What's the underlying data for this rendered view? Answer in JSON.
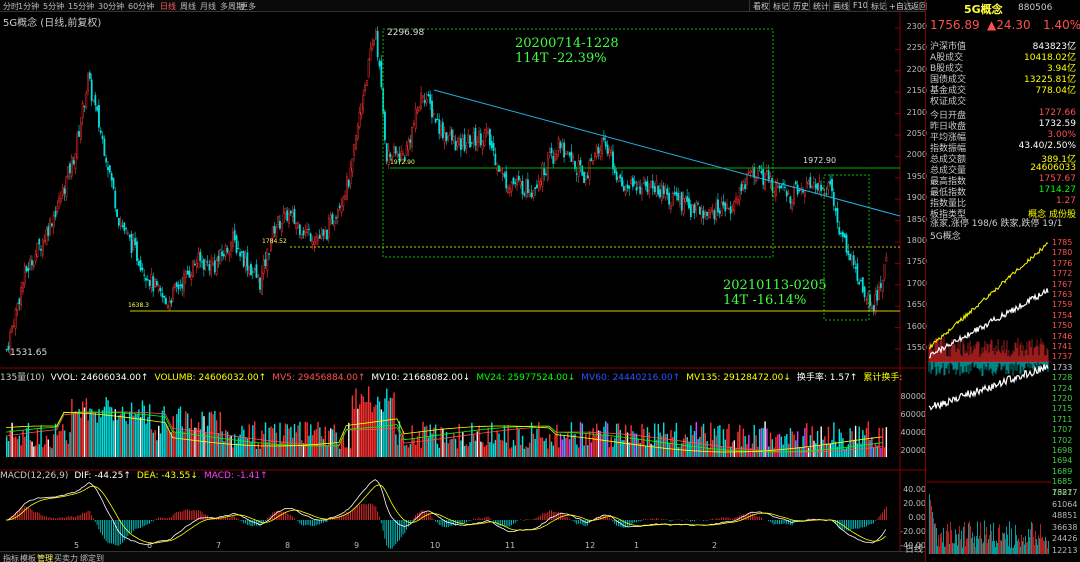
{
  "toolbar": {
    "periods": [
      "分时",
      "1分钟",
      "5分钟",
      "15分钟",
      "30分钟",
      "60分钟",
      "日线",
      "周线",
      "月线",
      "多周期",
      "更多"
    ],
    "active_period": "日线",
    "right_buttons": [
      "画线",
      "F10",
      "标记",
      "+自选",
      "返回"
    ],
    "mid_buttons": [
      "叠加",
      "统计",
      "历史",
      "标记",
      "看权"
    ]
  },
  "chart_title": "5G概念 (日线,前复权)",
  "price_axis": [
    "2300",
    "2250",
    "2200",
    "2150",
    "2100",
    "2050",
    "2000",
    "1950",
    "1900",
    "1850",
    "1800",
    "1750",
    "1700",
    "1650",
    "1600",
    "1550"
  ],
  "annotations": {
    "high_label": "2296.98",
    "low_label": "1531.65",
    "box1_title": "20200714-1228",
    "box1_stat": "114T -22.39%",
    "box2_title": "20210113-0205",
    "box2_stat": "14T -16.14%",
    "level1": "1972.90",
    "level1_left": "1972.90",
    "level2": "1784.52",
    "level3": "1638.3"
  },
  "volume_legend": {
    "items": [
      {
        "text": "135量(10)",
        "color": "#cccccc"
      },
      {
        "text": "VVOL: 24606034.00↑",
        "color": "#ffffff"
      },
      {
        "text": "VOLUMB: 24606032.00↑",
        "color": "#ffff00"
      },
      {
        "text": "MV5: 29456884.00↑",
        "color": "#ff5050"
      },
      {
        "text": "MV10: 21668082.00↓",
        "color": "#ffffff"
      },
      {
        "text": "MV24: 25977524.00↓",
        "color": "#00ff00"
      },
      {
        "text": "MV60: 24440216.00↑",
        "color": "#3050ff"
      },
      {
        "text": "MV135: 29128472.00↓",
        "color": "#ffff00"
      },
      {
        "text": "换手率: 1.57↑",
        "color": "#ffffff"
      },
      {
        "text": "累计换手: 13.80",
        "color": "#ffff00"
      }
    ],
    "axis": [
      "80000",
      "60000",
      "40000",
      "20000"
    ]
  },
  "macd_legend": {
    "items": [
      {
        "text": "MACD(12,26,9)",
        "color": "#cccccc"
      },
      {
        "text": "DIF: -44.25↑",
        "color": "#ffffff"
      },
      {
        "text": "DEA: -43.55↓",
        "color": "#ffff00"
      },
      {
        "text": "MACD: -1.41↑",
        "color": "#ff40ff"
      }
    ],
    "axis": [
      "40.00",
      "20.00",
      "0.00",
      "-20.00",
      "-40.00"
    ]
  },
  "month_axis": [
    "5",
    "6",
    "7",
    "8",
    "9",
    "10",
    "11",
    "12",
    "1",
    "2"
  ],
  "bottom_tabs": [
    "指标",
    "模板",
    "管理",
    "买卖力",
    "绑定到"
  ],
  "right_panel": {
    "name": "5G概念",
    "code": "880506",
    "price": "1756.89",
    "change": "▲24.30",
    "pct": "1.40%",
    "rows": [
      {
        "k": "沪深市值",
        "v": "843823亿",
        "c": "#ffffff"
      },
      {
        "k": "A股成交",
        "v": "10418.02亿",
        "c": "#ffff00"
      },
      {
        "k": "B股成交",
        "v": "3.94亿",
        "c": "#ffff00"
      },
      {
        "k": "国债成交",
        "v": "13225.81亿",
        "c": "#ffff00"
      },
      {
        "k": "基金成交",
        "v": "778.04亿",
        "c": "#ffff00"
      },
      {
        "k": "权证成交",
        "v": "",
        "c": "#ffff00"
      },
      {
        "k": "今日开盘",
        "v": "1727.66",
        "c": "#ff5050"
      },
      {
        "k": "昨日收盘",
        "v": "1732.59",
        "c": "#ffffff"
      },
      {
        "k": "平均涨幅",
        "v": "3.00%",
        "c": "#ff5050"
      },
      {
        "k": "指数振幅",
        "v": "43.40/2.50%",
        "c": "#ffffff"
      },
      {
        "k": "总成交额",
        "v": "389.1亿",
        "c": "#ffff00"
      },
      {
        "k": "总成交量",
        "v": "24606033",
        "c": "#ffff00"
      },
      {
        "k": "最高指数",
        "v": "1757.67",
        "c": "#ff5050"
      },
      {
        "k": "最低指数",
        "v": "1714.27",
        "c": "#00ff00"
      },
      {
        "k": "指数量比",
        "v": "1.27",
        "c": "#ff5050"
      },
      {
        "k": "板指类型",
        "v": "概念 成份股",
        "c": "#ffff00"
      }
    ],
    "updown": "涨家,涨停 198/6 跌家,跌停 19/1",
    "mini_title": "5G概念",
    "mini_axis": [
      "1785",
      "1780",
      "1776",
      "1772",
      "1767",
      "1763",
      "1759",
      "1754",
      "1750",
      "1746",
      "1741",
      "1737",
      "1733",
      "1728",
      "1724",
      "1720",
      "1715",
      "1711",
      "1707",
      "1702",
      "1698",
      "1694",
      "1689",
      "1685",
      "1681"
    ],
    "mini_vol_axis": [
      "73277",
      "61064",
      "48851",
      "36638",
      "24426",
      "12213"
    ],
    "bottom_label": "日线"
  }
}
